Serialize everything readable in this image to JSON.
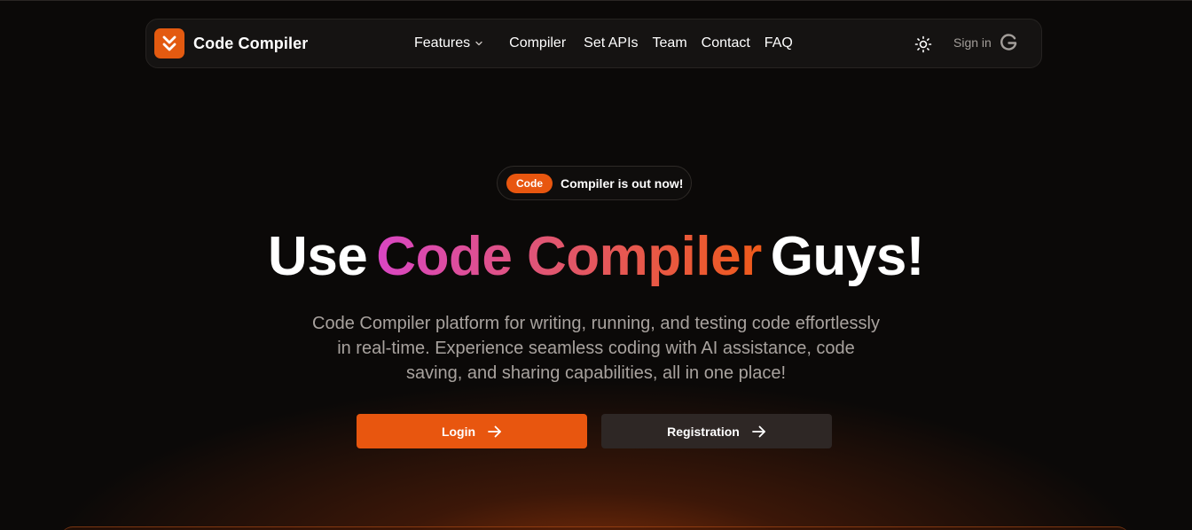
{
  "brand": {
    "name": "Code Compiler",
    "logo_icon": "double-chevron-down-icon",
    "logo_color": "#e35a10"
  },
  "nav": {
    "items": [
      {
        "label": "Features",
        "has_dropdown": true
      },
      {
        "label": "Compiler"
      },
      {
        "label": "Set APIs"
      },
      {
        "label": "Team"
      },
      {
        "label": "Contact"
      },
      {
        "label": "FAQ"
      }
    ],
    "theme_toggle_icon": "sun-icon",
    "signin_label": "Sign in",
    "signin_icon": "google-g-icon"
  },
  "announcement": {
    "badge": "Code",
    "text": "Compiler is out now!"
  },
  "hero": {
    "title_prefix": "Use",
    "title_accent": "Code Compiler",
    "title_suffix": "Guys!",
    "subtitle": "Code Compiler platform for writing, running, and testing code effortlessly in real-time. Experience seamless coding with AI assistance, code saving, and sharing capabilities, all in one place!"
  },
  "actions": {
    "login_label": "Login",
    "register_label": "Registration",
    "arrow_icon": "arrow-right-icon"
  },
  "colors": {
    "accent": "#e8560f",
    "background": "#0b0908",
    "gradient_start": "#d946c4",
    "gradient_end": "#ef5a1a",
    "secondary_button": "#2e2725"
  }
}
